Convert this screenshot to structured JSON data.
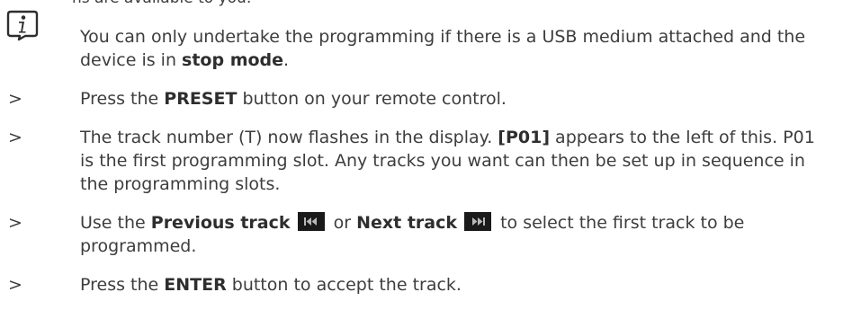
{
  "note": {
    "cutoff_text": "ns are available to you:",
    "icon": "info-icon",
    "part1": "You can only undertake the programming if there is a USB medium attached and the device is in ",
    "bold": "stop mode",
    "part2": "."
  },
  "steps": [
    {
      "bullet": ">",
      "part1": "Press the ",
      "bold": "PRESET",
      "part2": " button on your remote control."
    },
    {
      "bullet": ">",
      "part1": "The track number (T) now flashes in the display. ",
      "bold": "[P01]",
      "part2": " appears to the left of this. P01 is the first programming slot. Any tracks you want can then be set up in sequence in the programming slots."
    },
    {
      "bullet": ">",
      "part1": "Use the ",
      "bold1": "Previous track",
      "icon1": "previous-track-icon",
      "mid": " or ",
      "bold2": "Next track",
      "icon2": "next-track-icon",
      "part2": " to select the first track to be programmed."
    },
    {
      "bullet": ">",
      "part1": "Press the ",
      "bold": "ENTER",
      "part2": " button to accept the track."
    }
  ]
}
